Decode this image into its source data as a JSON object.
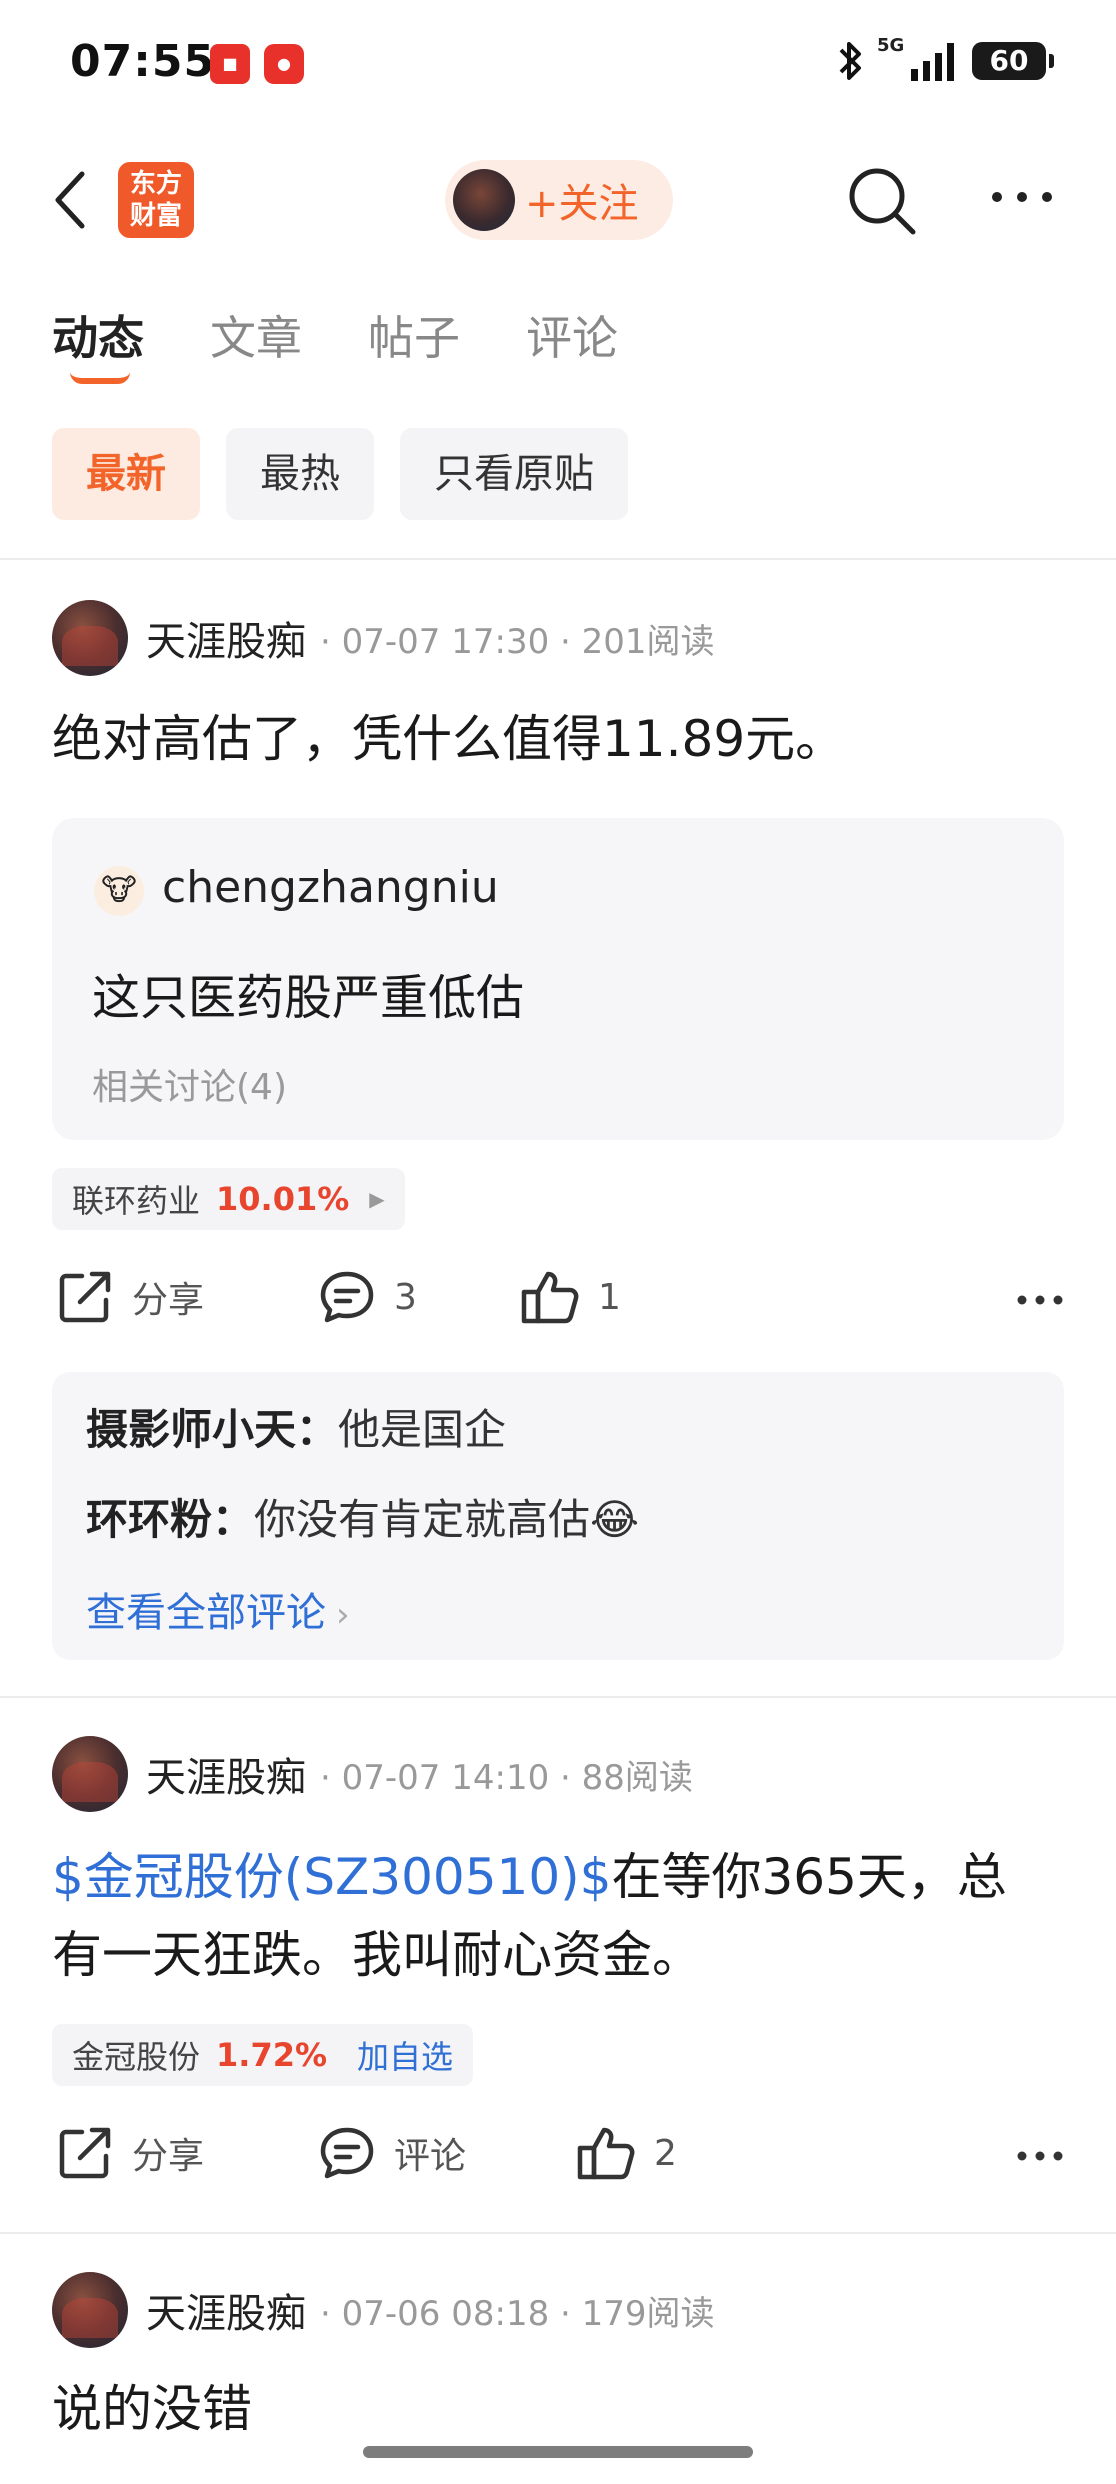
{
  "status_bar": {
    "time": "07:55",
    "network": "5G",
    "battery": "60",
    "icons": [
      "app-badge-icon",
      "app-badge-2-icon",
      "bluetooth-icon",
      "signal-icon",
      "battery-icon"
    ]
  },
  "nav": {
    "brand_line1": "东方",
    "brand_line2": "财富",
    "follow_label": "+关注"
  },
  "tabs": [
    {
      "label": "动态"
    },
    {
      "label": "文章"
    },
    {
      "label": "帖子"
    },
    {
      "label": "评论"
    }
  ],
  "filters": [
    {
      "label": "最新"
    },
    {
      "label": "最热"
    },
    {
      "label": "只看原贴"
    }
  ],
  "posts": [
    {
      "author": "天涯股痴",
      "meta": "· 07-07 17:30 · 201阅读",
      "text": "绝对高估了，凭什么值得11.89元。",
      "quote": {
        "user": "chengzhangniu",
        "text": "这只医药股严重低估",
        "related": "相关讨论(4)"
      },
      "stock": {
        "name": "联环药业",
        "pct": "10.01%"
      },
      "actions": {
        "share": "分享",
        "comment": "3",
        "like": "1"
      },
      "comments": [
        {
          "user": "摄影师小天：",
          "text": "他是国企"
        },
        {
          "user": "环环粉：",
          "text": "你没有肯定就高估😂"
        }
      ],
      "view_all": "查看全部评论"
    },
    {
      "author": "天涯股痴",
      "meta": "· 07-07 14:10 · 88阅读",
      "link": "$金冠股份(SZ300510)$",
      "text_line1": "在等你365天，总",
      "text_line2": "有一天狂跌。我叫耐心资金。",
      "stock": {
        "name": "金冠股份",
        "pct": "1.72%",
        "add": "加自选"
      },
      "actions": {
        "share": "分享",
        "comment": "评论",
        "like": "2"
      }
    },
    {
      "author": "天涯股痴",
      "meta": "· 07-06 08:18 · 179阅读",
      "text": "说的没错"
    }
  ]
}
